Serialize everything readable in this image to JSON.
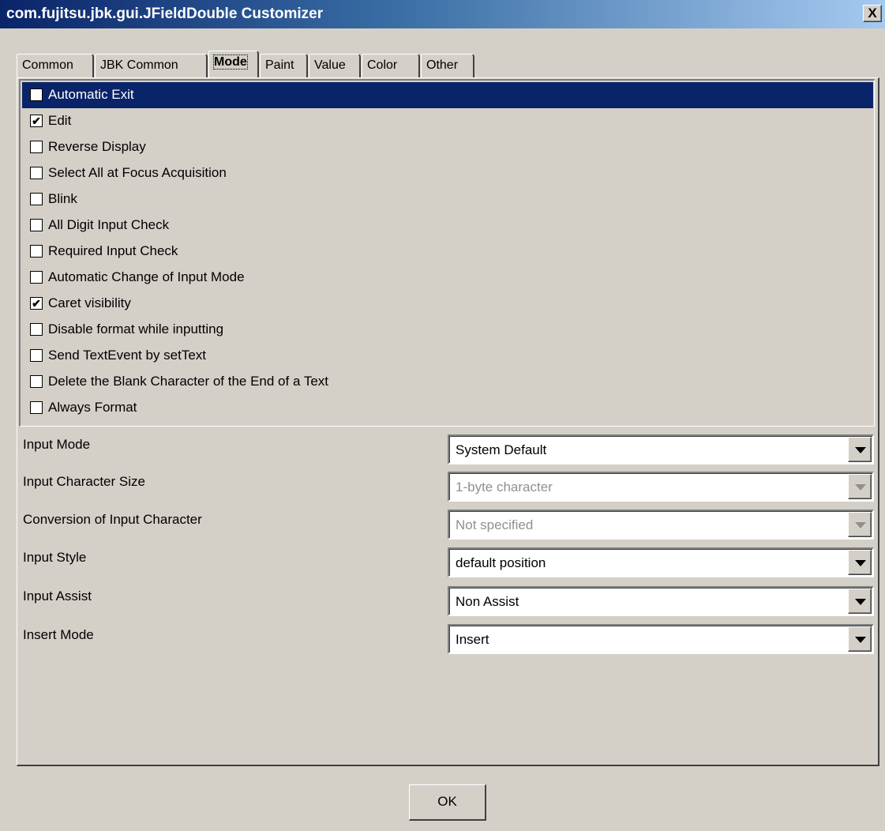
{
  "window": {
    "title": "com.fujitsu.jbk.gui.JFieldDouble Customizer",
    "close_label": "X"
  },
  "tabs": [
    {
      "label": "Common"
    },
    {
      "label": "JBK Common"
    },
    {
      "label": "Mode",
      "active": true
    },
    {
      "label": "Paint"
    },
    {
      "label": "Value"
    },
    {
      "label": "Color"
    },
    {
      "label": "Other"
    }
  ],
  "mode_options": [
    {
      "label": "Automatic Exit",
      "checked": false,
      "selected": true
    },
    {
      "label": "Edit",
      "checked": true
    },
    {
      "label": "Reverse Display",
      "checked": false
    },
    {
      "label": "Select All at Focus Acquisition",
      "checked": false
    },
    {
      "label": "Blink",
      "checked": false
    },
    {
      "label": "All Digit Input Check",
      "checked": false
    },
    {
      "label": "Required Input Check",
      "checked": false
    },
    {
      "label": "Automatic Change of Input Mode",
      "checked": false
    },
    {
      "label": "Caret visibility",
      "checked": true
    },
    {
      "label": "Disable format while inputting",
      "checked": false
    },
    {
      "label": "Send TextEvent by setText",
      "checked": false
    },
    {
      "label": "Delete the Blank Character of the End of a Text",
      "checked": false
    },
    {
      "label": "Always Format",
      "checked": false
    }
  ],
  "fields": [
    {
      "label": "Input Mode",
      "value": "System Default",
      "enabled": true
    },
    {
      "label": "Input Character Size",
      "value": "1-byte character",
      "enabled": false
    },
    {
      "label": "Conversion of Input Character",
      "value": "Not specified",
      "enabled": false
    },
    {
      "label": "Input Style",
      "value": "default position",
      "enabled": true
    },
    {
      "label": "Input Assist",
      "value": "Non Assist",
      "enabled": true
    },
    {
      "label": "Insert Mode",
      "value": "Insert",
      "enabled": true
    }
  ],
  "buttons": {
    "ok_label": "OK"
  }
}
